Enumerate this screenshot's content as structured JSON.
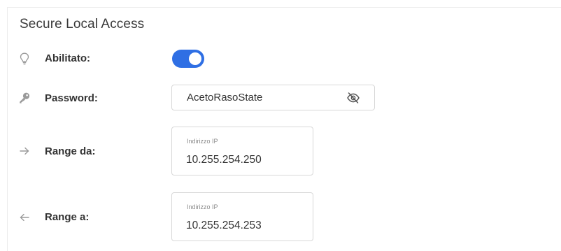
{
  "section": {
    "title": "Secure Local Access"
  },
  "rows": {
    "enabled": {
      "icon": "lightbulb-icon",
      "label": "Abilitato:",
      "toggle_on": true
    },
    "password": {
      "icon": "key-icon",
      "label": "Password:",
      "value": "AcetoRasoState",
      "visibility_icon": "eye-off-icon"
    },
    "range_from": {
      "icon": "arrow-right-icon",
      "label": "Range da:",
      "field_label": "Indirizzo IP",
      "value": "10.255.254.250"
    },
    "range_to": {
      "icon": "arrow-left-icon",
      "label": "Range a:",
      "field_label": "Indirizzo IP",
      "value": "10.255.254.253"
    }
  },
  "colors": {
    "accent": "#2f6fe4",
    "border": "#d8d8d8",
    "icon": "#9a9a9a"
  }
}
